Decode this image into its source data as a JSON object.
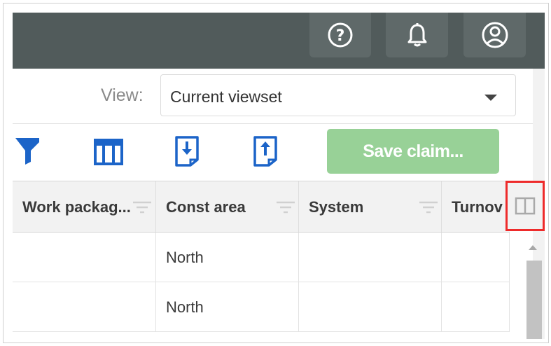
{
  "header": {
    "buttons": [
      {
        "icon": "help-icon"
      },
      {
        "icon": "bell-icon"
      },
      {
        "icon": "user-icon"
      }
    ],
    "bar_color": "#515b5b"
  },
  "view": {
    "label": "View:",
    "selected": "Current viewset"
  },
  "toolbar": {
    "icons": [
      "filter-icon",
      "columns-icon",
      "import-icon",
      "export-icon"
    ],
    "save_label": "Save claim...",
    "save_color": "#98d197",
    "accent": "#1c64c8"
  },
  "table": {
    "columns": [
      "Work packag...",
      "Const area",
      "System",
      "Turnov"
    ],
    "rows": [
      [
        "",
        "North",
        "",
        ""
      ],
      [
        "",
        "North",
        "",
        ""
      ]
    ],
    "column_chooser_icon": "column-chooser-icon",
    "highlight_color": "#ee2b2b"
  }
}
